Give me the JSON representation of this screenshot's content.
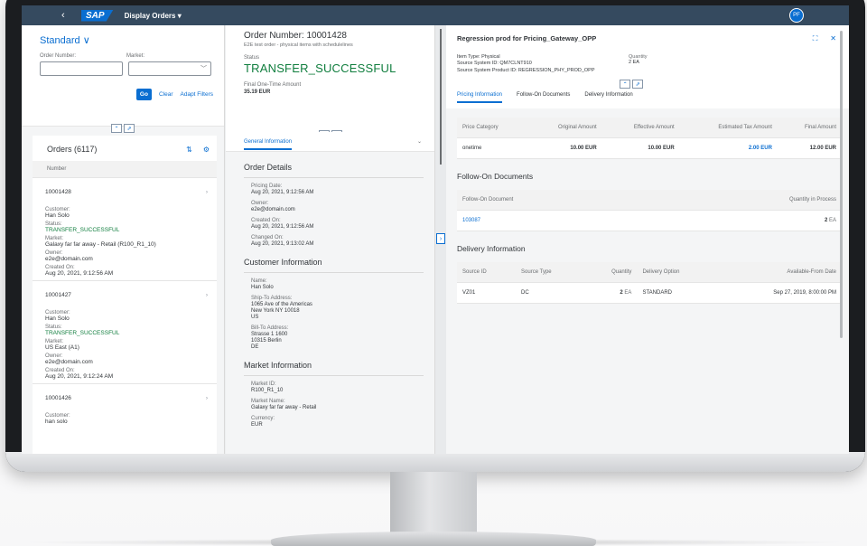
{
  "shell": {
    "back_icon": "back-icon",
    "logo": "SAP",
    "app_title": "Display Orders ▾",
    "avatar": "PF"
  },
  "filter": {
    "variant": "Standard ∨",
    "order_number_label": "Order Number:",
    "market_label": "Market:",
    "go": "Go",
    "clear": "Clear",
    "adapt": "Adapt Filters"
  },
  "orders": {
    "title": "Orders (6117)",
    "column": "Number",
    "items": [
      {
        "number": "10001428",
        "customer_label": "Customer:",
        "customer": "Han Solo",
        "status_label": "Status:",
        "status": "TRANSFER_SUCCESSFUL",
        "market_label": "Market:",
        "market": "Galaxy far far away - Retail (R100_R1_10)",
        "owner_label": "Owner:",
        "owner": "e2e@domain.com",
        "created_label": "Created On:",
        "created": "Aug 20, 2021, 9:12:56 AM"
      },
      {
        "number": "10001427",
        "customer_label": "Customer:",
        "customer": "Han Solo",
        "status_label": "Status:",
        "status": "TRANSFER_SUCCESSFUL",
        "market_label": "Market:",
        "market": "US East (A1)",
        "owner_label": "Owner:",
        "owner": "e2e@domain.com",
        "created_label": "Created On:",
        "created": "Aug 20, 2021, 9:12:24 AM"
      },
      {
        "number": "10001426",
        "customer_label": "Customer:",
        "customer": "han solo"
      }
    ]
  },
  "detail": {
    "title": "Order Number: 10001428",
    "subtitle": "E2E test order - physical items with schedulelines",
    "status_label": "Status",
    "status": "TRANSFER_SUCCESSFUL",
    "amount_label": "Final One-Time Amount",
    "amount": "35.19 EUR",
    "tab": "General Information",
    "order_details": "Order Details",
    "pricing_date_label": "Pricing Date:",
    "pricing_date": "Aug 20, 2021, 9:12:56 AM",
    "owner_label": "Owner:",
    "owner": "e2e@domain.com",
    "created_label": "Created On:",
    "created": "Aug 20, 2021, 9:12:56 AM",
    "changed_label": "Changed On:",
    "changed": "Aug 20, 2021, 9:13:02 AM",
    "customer_info": "Customer Information",
    "name_label": "Name:",
    "name": "Han Solo",
    "shipto_label": "Ship-To Address:",
    "shipto1": "1065 Ave of the Americas",
    "shipto2": "New York NY 10018",
    "shipto3": "US",
    "billto_label": "Bill-To Address:",
    "billto1": "Strasse 1 1600",
    "billto2": "10315 Berlin",
    "billto3": "DE",
    "market_info": "Market Information",
    "market_id_label": "Market ID:",
    "market_id": "R100_R1_10",
    "market_name_label": "Market Name:",
    "market_name": "Galaxy far far away - Retail",
    "currency_label": "Currency:",
    "currency": "EUR"
  },
  "item": {
    "title": "Regression prod for Pricing_Gateway_OPP",
    "type": "Item Type: Physical",
    "source_id": "Source System ID: QM7CLNT910",
    "source_prod": "Source System Product ID: REGRESSION_PHY_PROD_OPP",
    "qty_label": "Quantity",
    "qty": "2 EA",
    "tabs": [
      "Pricing Information",
      "Follow-On Documents",
      "Delivery Information"
    ],
    "pricing": {
      "headers": [
        "Price Category",
        "Original Amount",
        "Effective Amount",
        "Estimated Tax Amount",
        "Final Amount"
      ],
      "row": [
        "onetime",
        "10.00 EUR",
        "10.00 EUR",
        "2.00 EUR",
        "12.00 EUR"
      ]
    },
    "followon_title": "Follow-On Documents",
    "followon": {
      "headers": [
        "Follow-On Document",
        "Quantity in Process"
      ],
      "doc": "103087",
      "qty": "2",
      "unit": "EA"
    },
    "delivery_title": "Delivery Information",
    "delivery": {
      "headers": [
        "Source ID",
        "Source Type",
        "Quantity",
        "Delivery Option",
        "Available-From Date"
      ],
      "row": {
        "source_id": "VZ01",
        "source_type": "DC",
        "qty": "2",
        "unit": "EA",
        "option": "STANDARD",
        "date": "Sep 27, 2019, 8:00:00 PM"
      }
    }
  },
  "colors": {
    "shell": "#354a5f",
    "accent": "#0a6ed1",
    "positive": "#107e3e"
  }
}
